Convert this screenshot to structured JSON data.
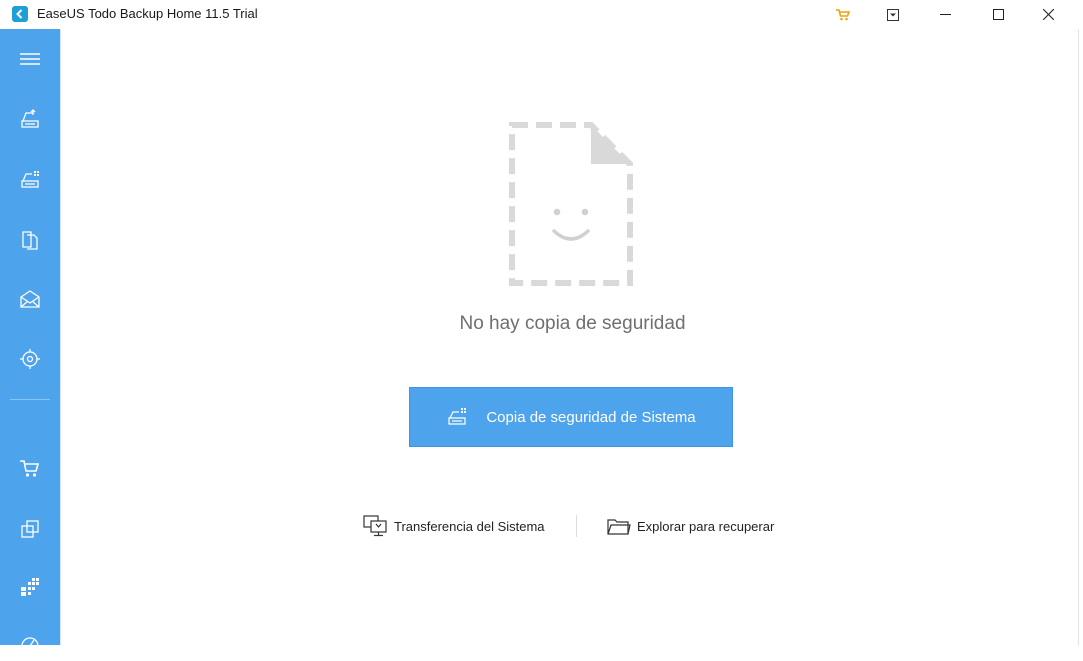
{
  "window": {
    "title": "EaseUS Todo Backup Home 11.5 Trial",
    "controls": [
      "cart-icon",
      "menu-dropdown-icon",
      "minimize-icon",
      "maximize-icon",
      "close-icon"
    ]
  },
  "sidebar": {
    "items": [
      {
        "name": "menu",
        "icon": "hamburger-icon"
      },
      {
        "name": "disk-backup",
        "icon": "disk-backup-icon"
      },
      {
        "name": "system-backup",
        "icon": "system-backup-icon"
      },
      {
        "name": "file-backup",
        "icon": "file-backup-icon"
      },
      {
        "name": "mail-backup",
        "icon": "mail-backup-icon"
      },
      {
        "name": "smart-backup",
        "icon": "target-icon"
      },
      {
        "name": "store",
        "icon": "cart-icon"
      },
      {
        "name": "clone",
        "icon": "clone-icon"
      },
      {
        "name": "tools",
        "icon": "tools-grid-icon"
      },
      {
        "name": "more",
        "icon": "gauge-icon"
      }
    ]
  },
  "main": {
    "empty_message": "No hay copia de seguridad",
    "primary_button_label": "Copia de seguridad de Sistema",
    "links": {
      "transfer": "Transferencia del Sistema",
      "explore": "Explorar para recuperar"
    }
  },
  "colors": {
    "sidebar": "#4da3ec",
    "accent": "#4da3ec",
    "cart": "#f0a30a",
    "placeholder": "#d9d9d9"
  }
}
